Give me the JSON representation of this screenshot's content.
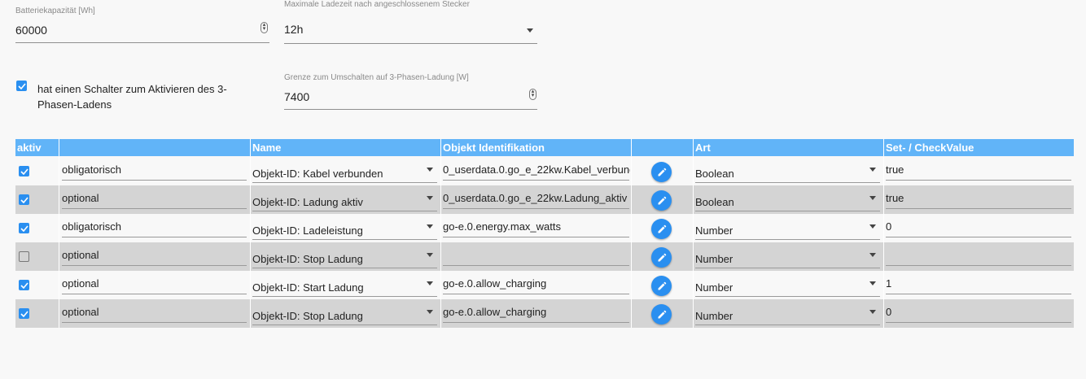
{
  "form": {
    "battery_capacity": {
      "label": "Batteriekapazität [Wh]",
      "value": "60000"
    },
    "max_charge_time": {
      "label": "Maximale Ladezeit nach angeschlossenem Stecker",
      "value": "12h"
    },
    "three_phase_switch": {
      "checked": true,
      "label_line1": "hat einen Schalter zum Aktivieren des 3-",
      "label_line2": "Phasen-Ladens"
    },
    "three_phase_threshold": {
      "label": "Grenze zum Umschalten auf 3-Phasen-Ladung [W]",
      "value": "7400"
    }
  },
  "table": {
    "headers": [
      "aktiv",
      "",
      "Name",
      "Objekt Identifikation",
      "",
      "Art",
      "Set- / CheckValue"
    ],
    "rows": [
      {
        "active": true,
        "requirement": "obligatorisch",
        "name": "Objekt-ID: Kabel verbunden",
        "object_id": "0_userdata.0.go_e_22kw.Kabel_verbund",
        "type": "Boolean",
        "value": "true"
      },
      {
        "active": true,
        "requirement": "optional",
        "name": "Objekt-ID: Ladung aktiv",
        "object_id": "0_userdata.0.go_e_22kw.Ladung_aktiv",
        "type": "Boolean",
        "value": "true"
      },
      {
        "active": true,
        "requirement": "obligatorisch",
        "name": "Objekt-ID: Ladeleistung",
        "object_id": "go-e.0.energy.max_watts",
        "type": "Number",
        "value": "0"
      },
      {
        "active": false,
        "requirement": "optional",
        "name": "Objekt-ID: Stop Ladung",
        "object_id": "",
        "type": "Number",
        "value": ""
      },
      {
        "active": true,
        "requirement": "optional",
        "name": "Objekt-ID: Start Ladung",
        "object_id": "go-e.0.allow_charging",
        "type": "Number",
        "value": "1"
      },
      {
        "active": true,
        "requirement": "optional",
        "name": "Objekt-ID: Stop Ladung",
        "object_id": "go-e.0.allow_charging",
        "type": "Number",
        "value": "0"
      }
    ]
  },
  "icons": {
    "edit": "pencil-icon",
    "checkbox": "check-icon",
    "dropdown": "caret-down-icon",
    "spinner": "spinner-arrows-icon"
  },
  "colors": {
    "accent": "#2a8ff0",
    "header": "#61b4f8",
    "row_alt": "#d4d4d4",
    "background": "#f8f8f8"
  }
}
